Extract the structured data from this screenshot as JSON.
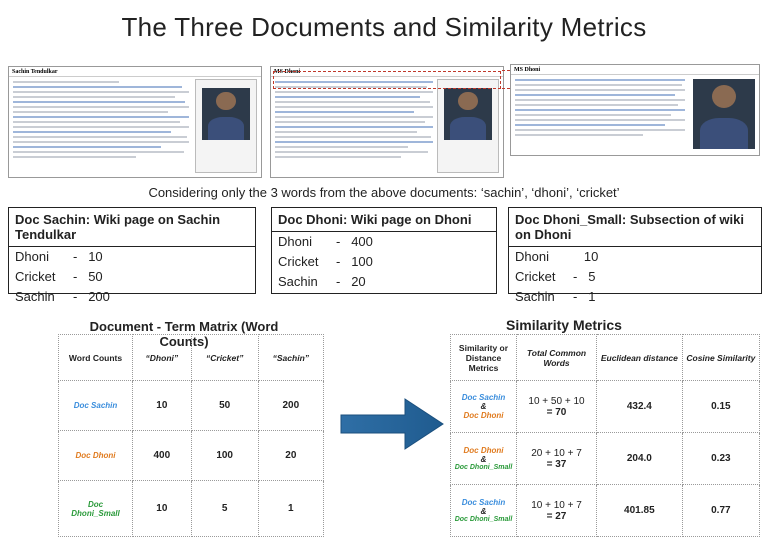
{
  "title": "The Three Documents and Similarity Metrics",
  "thumbnails": [
    {
      "heading": "Sachin Tendulkar"
    },
    {
      "heading": "MS Dhoni"
    },
    {
      "heading": "MS Dhoni"
    }
  ],
  "subtitle": "Considering only the 3 words from the above documents: ‘sachin’, ‘dhoni’, ‘cricket’",
  "docs": [
    {
      "header": "Doc Sachin: Wiki page on Sachin Tendulkar",
      "rows": [
        {
          "word": "Dhoni",
          "sep": "-",
          "count": "10"
        },
        {
          "word": "Cricket",
          "sep": "-",
          "count": "50"
        },
        {
          "word": "Sachin",
          "sep": "-",
          "count": "200"
        }
      ]
    },
    {
      "header": "Doc Dhoni: Wiki page on Dhoni",
      "rows": [
        {
          "word": "Dhoni",
          "sep": "-",
          "count": "400"
        },
        {
          "word": "Cricket",
          "sep": "-",
          "count": "100"
        },
        {
          "word": "Sachin",
          "sep": "-",
          "count": "20"
        }
      ]
    },
    {
      "header": "Doc Dhoni_Small: Subsection of wiki on Dhoni",
      "rows": [
        {
          "word": "Dhoni",
          "sep": "",
          "count": "10"
        },
        {
          "word": "Cricket",
          "sep": "-",
          "count": "5"
        },
        {
          "word": "Sachin",
          "sep": "-",
          "count": "1"
        }
      ]
    }
  ],
  "matrix": {
    "title": "Document - Term Matrix (Word Counts)",
    "headers": [
      "Word Counts",
      "“Dhoni”",
      "“Cricket”",
      "“Sachin”"
    ],
    "rows": [
      {
        "doc": "Doc Sachin",
        "values": [
          "10",
          "50",
          "200"
        ]
      },
      {
        "doc": "Doc Dhoni",
        "values": [
          "400",
          "100",
          "20"
        ]
      },
      {
        "doc_line1": "Doc",
        "doc_line2": "Dhoni_Small",
        "values": [
          "10",
          "5",
          "1"
        ]
      }
    ]
  },
  "similarity": {
    "title": "Similarity Metrics",
    "headers": [
      "Similarity or Distance Metrics",
      "Total Common Words",
      "Euclidean distance",
      "Cosine Similarity"
    ],
    "amp": "&",
    "rows": [
      {
        "doc_a": "Doc Sachin",
        "doc_b": "Doc Dhoni",
        "sum": "10 + 50 + 10",
        "total": "= 70",
        "euclid": "432.4",
        "cosine": "0.15"
      },
      {
        "doc_a": "Doc Dhoni",
        "doc_b": "Doc Dhoni_Small",
        "sum": "20 + 10 + 7",
        "total": "= 37",
        "euclid": "204.0",
        "cosine": "0.23"
      },
      {
        "doc_a": "Doc Sachin",
        "doc_b": "Doc Dhoni_Small",
        "sum": "10 + 10 + 7",
        "total": "= 27",
        "euclid": "401.85",
        "cosine": "0.77"
      }
    ]
  },
  "colors": {
    "sachin": "#3a8ddc",
    "dhoni": "#e07b1f",
    "dhoni_small": "#2a9a3a",
    "arrow": "#1f5b8f"
  }
}
